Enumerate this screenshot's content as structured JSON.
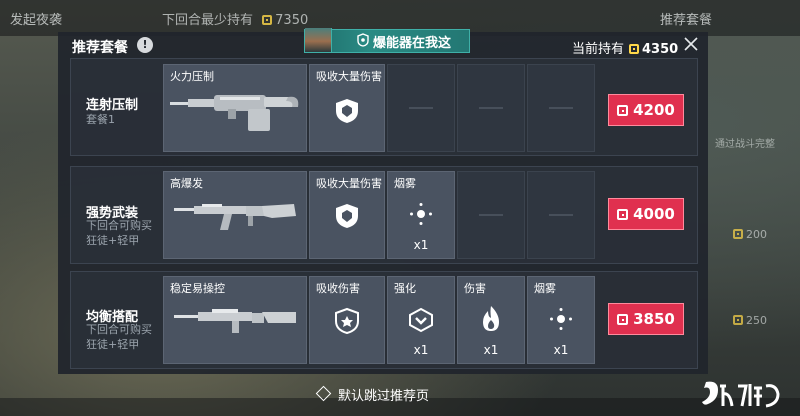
{
  "background": {
    "top_left_text": "发起夜袭",
    "top_mid_text": "下回合最少持有",
    "top_mid_value": "7350",
    "top_right_text": "推荐套餐",
    "right_text": "通过战斗完整",
    "right_values": [
      "200",
      "250"
    ]
  },
  "panel": {
    "title": "推荐套餐",
    "info_label": "!",
    "header_center": "爆能器在我这",
    "holdings_label": "当前持有",
    "holdings_value": "4350",
    "skip_label": "默认跳过推荐页"
  },
  "packages": [
    {
      "name": "连射压制",
      "subtitle": "套餐1",
      "price": "4200",
      "weapon_label": "火力压制",
      "items": [
        {
          "label": "吸收大量伤害",
          "icon": "heavy-armor-icon",
          "count": ""
        }
      ]
    },
    {
      "name": "强势武装",
      "subtitle": "下回合可购买狂徒+轻甲",
      "price": "4000",
      "weapon_label": "高爆发",
      "items": [
        {
          "label": "吸收大量伤害",
          "icon": "heavy-armor-icon",
          "count": ""
        },
        {
          "label": "烟雾",
          "icon": "smoke-icon",
          "count": "x1"
        }
      ]
    },
    {
      "name": "均衡搭配",
      "subtitle": "下回合可购买狂徒+轻甲",
      "price": "3850",
      "weapon_label": "稳定易操控",
      "items": [
        {
          "label": "吸收伤害",
          "icon": "light-armor-icon",
          "count": ""
        },
        {
          "label": "强化",
          "icon": "boost-icon",
          "count": "x1"
        },
        {
          "label": "伤害",
          "icon": "flame-icon",
          "count": "x1"
        },
        {
          "label": "烟雾",
          "icon": "smoke-icon",
          "count": "x1"
        }
      ]
    }
  ],
  "colors": {
    "price_button": "#e0304f",
    "accent_teal": "#2a8b84",
    "currency": "#ffd84a"
  }
}
